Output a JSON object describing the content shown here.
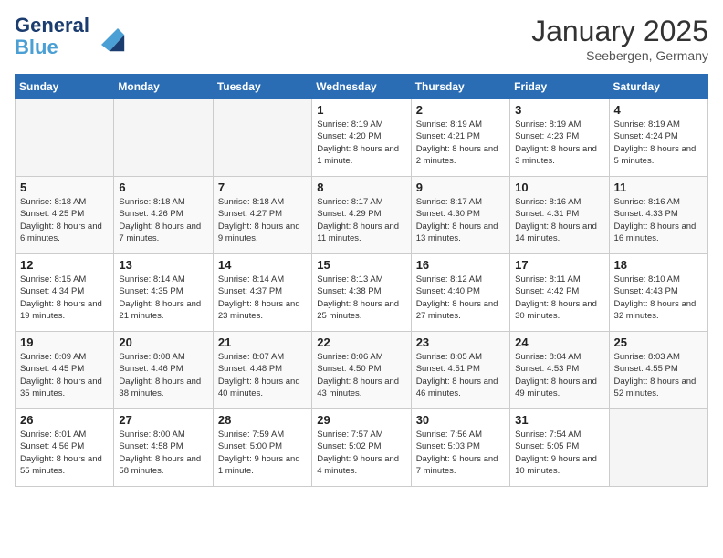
{
  "header": {
    "logo_line1": "General",
    "logo_line2": "Blue",
    "title": "January 2025",
    "subtitle": "Seebergen, Germany"
  },
  "weekdays": [
    "Sunday",
    "Monday",
    "Tuesday",
    "Wednesday",
    "Thursday",
    "Friday",
    "Saturday"
  ],
  "weeks": [
    [
      {
        "day": "",
        "empty": true
      },
      {
        "day": "",
        "empty": true
      },
      {
        "day": "",
        "empty": true
      },
      {
        "day": "1",
        "sunrise": "8:19 AM",
        "sunset": "4:20 PM",
        "daylight": "8 hours and 1 minute."
      },
      {
        "day": "2",
        "sunrise": "8:19 AM",
        "sunset": "4:21 PM",
        "daylight": "8 hours and 2 minutes."
      },
      {
        "day": "3",
        "sunrise": "8:19 AM",
        "sunset": "4:23 PM",
        "daylight": "8 hours and 3 minutes."
      },
      {
        "day": "4",
        "sunrise": "8:19 AM",
        "sunset": "4:24 PM",
        "daylight": "8 hours and 5 minutes."
      }
    ],
    [
      {
        "day": "5",
        "sunrise": "8:18 AM",
        "sunset": "4:25 PM",
        "daylight": "8 hours and 6 minutes."
      },
      {
        "day": "6",
        "sunrise": "8:18 AM",
        "sunset": "4:26 PM",
        "daylight": "8 hours and 7 minutes."
      },
      {
        "day": "7",
        "sunrise": "8:18 AM",
        "sunset": "4:27 PM",
        "daylight": "8 hours and 9 minutes."
      },
      {
        "day": "8",
        "sunrise": "8:17 AM",
        "sunset": "4:29 PM",
        "daylight": "8 hours and 11 minutes."
      },
      {
        "day": "9",
        "sunrise": "8:17 AM",
        "sunset": "4:30 PM",
        "daylight": "8 hours and 13 minutes."
      },
      {
        "day": "10",
        "sunrise": "8:16 AM",
        "sunset": "4:31 PM",
        "daylight": "8 hours and 14 minutes."
      },
      {
        "day": "11",
        "sunrise": "8:16 AM",
        "sunset": "4:33 PM",
        "daylight": "8 hours and 16 minutes."
      }
    ],
    [
      {
        "day": "12",
        "sunrise": "8:15 AM",
        "sunset": "4:34 PM",
        "daylight": "8 hours and 19 minutes."
      },
      {
        "day": "13",
        "sunrise": "8:14 AM",
        "sunset": "4:35 PM",
        "daylight": "8 hours and 21 minutes."
      },
      {
        "day": "14",
        "sunrise": "8:14 AM",
        "sunset": "4:37 PM",
        "daylight": "8 hours and 23 minutes."
      },
      {
        "day": "15",
        "sunrise": "8:13 AM",
        "sunset": "4:38 PM",
        "daylight": "8 hours and 25 minutes."
      },
      {
        "day": "16",
        "sunrise": "8:12 AM",
        "sunset": "4:40 PM",
        "daylight": "8 hours and 27 minutes."
      },
      {
        "day": "17",
        "sunrise": "8:11 AM",
        "sunset": "4:42 PM",
        "daylight": "8 hours and 30 minutes."
      },
      {
        "day": "18",
        "sunrise": "8:10 AM",
        "sunset": "4:43 PM",
        "daylight": "8 hours and 32 minutes."
      }
    ],
    [
      {
        "day": "19",
        "sunrise": "8:09 AM",
        "sunset": "4:45 PM",
        "daylight": "8 hours and 35 minutes."
      },
      {
        "day": "20",
        "sunrise": "8:08 AM",
        "sunset": "4:46 PM",
        "daylight": "8 hours and 38 minutes."
      },
      {
        "day": "21",
        "sunrise": "8:07 AM",
        "sunset": "4:48 PM",
        "daylight": "8 hours and 40 minutes."
      },
      {
        "day": "22",
        "sunrise": "8:06 AM",
        "sunset": "4:50 PM",
        "daylight": "8 hours and 43 minutes."
      },
      {
        "day": "23",
        "sunrise": "8:05 AM",
        "sunset": "4:51 PM",
        "daylight": "8 hours and 46 minutes."
      },
      {
        "day": "24",
        "sunrise": "8:04 AM",
        "sunset": "4:53 PM",
        "daylight": "8 hours and 49 minutes."
      },
      {
        "day": "25",
        "sunrise": "8:03 AM",
        "sunset": "4:55 PM",
        "daylight": "8 hours and 52 minutes."
      }
    ],
    [
      {
        "day": "26",
        "sunrise": "8:01 AM",
        "sunset": "4:56 PM",
        "daylight": "8 hours and 55 minutes."
      },
      {
        "day": "27",
        "sunrise": "8:00 AM",
        "sunset": "4:58 PM",
        "daylight": "8 hours and 58 minutes."
      },
      {
        "day": "28",
        "sunrise": "7:59 AM",
        "sunset": "5:00 PM",
        "daylight": "9 hours and 1 minute."
      },
      {
        "day": "29",
        "sunrise": "7:57 AM",
        "sunset": "5:02 PM",
        "daylight": "9 hours and 4 minutes."
      },
      {
        "day": "30",
        "sunrise": "7:56 AM",
        "sunset": "5:03 PM",
        "daylight": "9 hours and 7 minutes."
      },
      {
        "day": "31",
        "sunrise": "7:54 AM",
        "sunset": "5:05 PM",
        "daylight": "9 hours and 10 minutes."
      },
      {
        "day": "",
        "empty": true
      }
    ]
  ]
}
